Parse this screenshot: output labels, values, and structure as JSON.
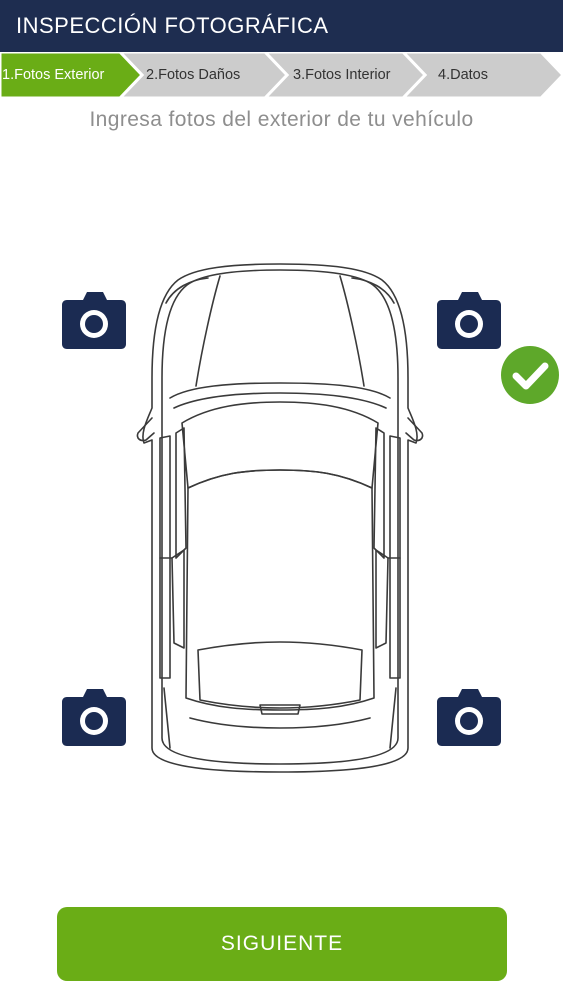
{
  "header": {
    "title": "INSPECCIÓN FOTOGRÁFICA"
  },
  "steps": [
    {
      "label": "1.Fotos Exterior",
      "active": true
    },
    {
      "label": "2.Fotos Daños",
      "active": false
    },
    {
      "label": "3.Fotos Interior",
      "active": false
    },
    {
      "label": "4.Datos",
      "active": false
    }
  ],
  "main": {
    "subtitle": "Ingresa fotos del exterior de tu vehículo",
    "photo_slots": [
      {
        "position": "front-left",
        "icon": "camera-icon",
        "done": false
      },
      {
        "position": "front-right",
        "icon": "camera-icon",
        "done": true
      },
      {
        "position": "rear-left",
        "icon": "camera-icon",
        "done": false
      },
      {
        "position": "rear-right",
        "icon": "camera-icon",
        "done": false
      }
    ]
  },
  "footer": {
    "next_label": "SIGUIENTE"
  },
  "colors": {
    "header_bg": "#1e2d50",
    "accent_green": "#6aad16",
    "check_green": "#5ea82a",
    "camera_navy": "#1b2b52",
    "step_inactive": "#cccccc"
  }
}
